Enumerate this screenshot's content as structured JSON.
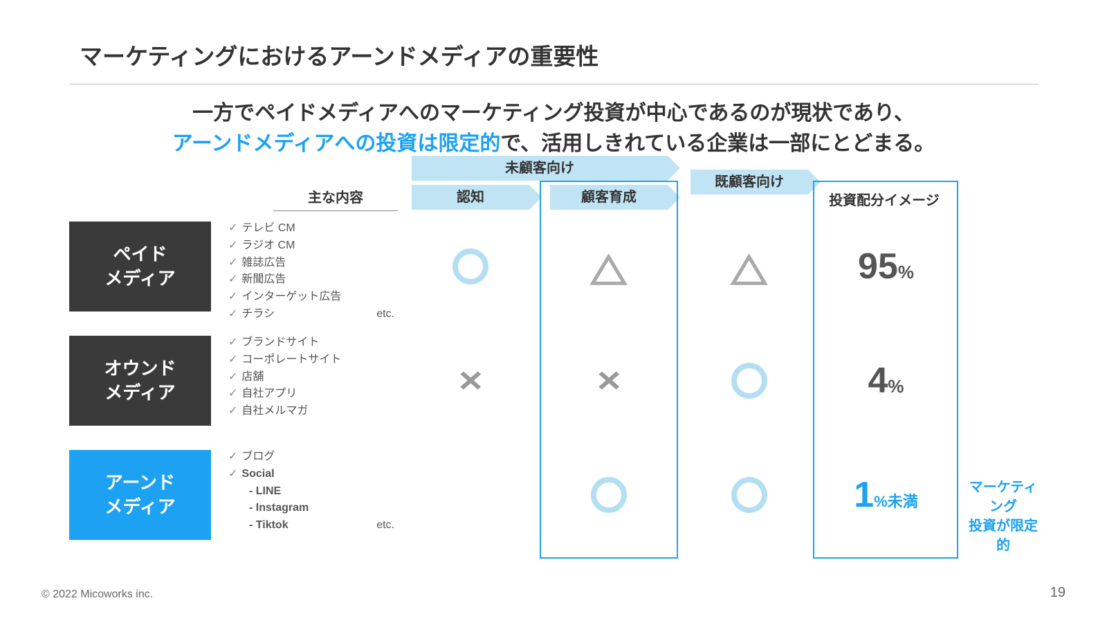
{
  "title": "マーケティングにおけるアーンドメディアの重要性",
  "subtitle": {
    "line1": "一方でペイドメディアへのマーケティング投資が中心であるのが現状であり、",
    "line2_blue": "アーンドメディアへの投資は限定的",
    "line2_black": "で、活用しきれている企業は一部にとどまる。"
  },
  "columns": {
    "content": "主な内容",
    "prospect_banner": "未顧客向け",
    "awareness": "認知",
    "nurturing": "顧客育成",
    "existing": "既顧客向け",
    "invest": "投資配分イメージ"
  },
  "rows": [
    {
      "name": "ペイド\nメディア",
      "items": [
        "テレビ CM",
        "ラジオ CM",
        "雑誌広告",
        "新聞広告",
        "インターゲット広告",
        "チラシ"
      ],
      "etc": "etc.",
      "sym": [
        "circle",
        "tri",
        "tri"
      ],
      "pct": "95",
      "pct_suffix": "%"
    },
    {
      "name": "オウンド\nメディア",
      "items": [
        "ブランドサイト",
        "コーポレートサイト",
        "店舗",
        "自社アプリ",
        "自社メルマガ"
      ],
      "etc": "",
      "sym": [
        "x",
        "x",
        "circle"
      ],
      "pct": "4",
      "pct_suffix": "%"
    },
    {
      "name": "アーンド\nメディア",
      "items": [
        "ブログ",
        "Social"
      ],
      "sub": [
        "- LINE",
        "- Instagram",
        "- Tiktok"
      ],
      "etc": "etc.",
      "sym": [
        "",
        "circle",
        "circle"
      ],
      "pct": "1",
      "pct_suffix": "%未満",
      "pct_blue": true
    }
  ],
  "note": "マーケティング\n投資が限定的",
  "footer": {
    "copyright": "© 2022 Micoworks inc.",
    "page": "19"
  }
}
